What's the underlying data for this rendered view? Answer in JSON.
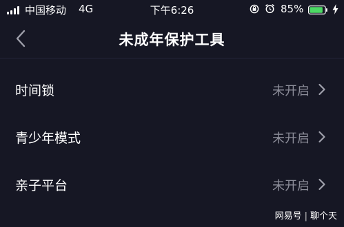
{
  "status_bar": {
    "carrier": "中国移动",
    "network": "4G",
    "time": "下午6:26",
    "battery": "85%",
    "icons": [
      "signal-icon",
      "rotation-lock-icon",
      "alarm-icon",
      "battery-icon",
      "charging-icon"
    ],
    "battery_color": "#4cd964"
  },
  "nav": {
    "title": "未成年保护工具",
    "back_icon": "chevron-left-icon"
  },
  "settings": {
    "items": [
      {
        "label": "时间锁",
        "value": "未开启"
      },
      {
        "label": "青少年模式",
        "value": "未开启"
      },
      {
        "label": "亲子平台",
        "value": "未开启"
      }
    ]
  },
  "watermark": {
    "source": "网易号",
    "author": "聊个天"
  },
  "colors": {
    "background": "#161724",
    "secondary_text": "#8c8d99"
  }
}
